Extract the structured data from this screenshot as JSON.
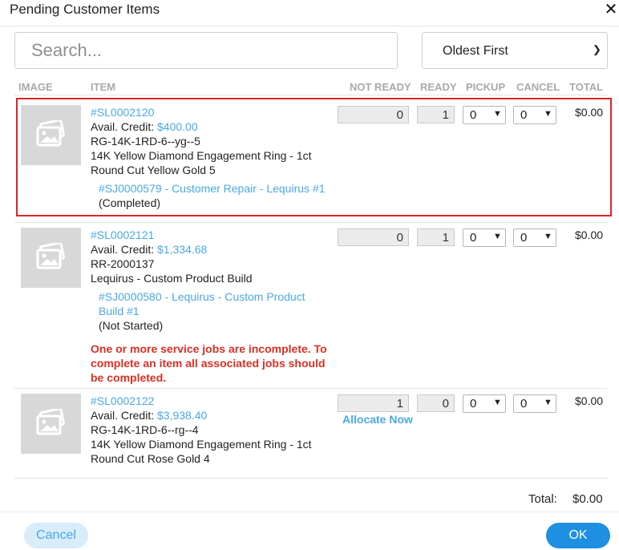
{
  "dialog": {
    "title": "Pending Customer Items",
    "close_icon": "close-icon"
  },
  "search": {
    "placeholder": "Search..."
  },
  "sort": {
    "selected": "Oldest First"
  },
  "columns": {
    "image": "IMAGE",
    "item": "ITEM",
    "not_ready": "NOT READY",
    "ready": "READY",
    "pickup": "PICKUP",
    "cancel": "CANCEL",
    "total": "TOTAL"
  },
  "rows": [
    {
      "sl": "#SL0002120",
      "credit_label": "Avail. Credit:",
      "credit": "$400.00",
      "sku": "RG-14K-1RD-6--yg--5",
      "desc1": "14K Yellow Diamond Engagement Ring - 1ct",
      "desc2": "Round Cut Yellow Gold 5",
      "job": "#SJ0000579 - Customer Repair - Lequirus #1",
      "job_status": "(Completed)",
      "not_ready": "0",
      "ready": "1",
      "pickup": "0",
      "cancel": "0",
      "total": "$0.00"
    },
    {
      "sl": "#SL0002121",
      "credit_label": "Avail. Credit:",
      "credit": "$1,334.68",
      "sku": "RR-2000137",
      "desc1": "Lequirus - Custom Product Build",
      "job_line1": "#SJ0000580 - Lequirus - Custom Product",
      "job_line2": "Build #1",
      "job_status": "(Not Started)",
      "warning": "One or more service jobs are incomplete. To complete an item all associated jobs should be completed.",
      "not_ready": "0",
      "ready": "1",
      "pickup": "0",
      "cancel": "0",
      "total": "$0.00"
    },
    {
      "sl": "#SL0002122",
      "credit_label": "Avail. Credit:",
      "credit": "$3,938.40",
      "sku": "RG-14K-1RD-6--rg--4",
      "desc1": "14K Yellow Diamond Engagement Ring - 1ct",
      "desc2": "Round Cut Rose Gold 4",
      "allocate": "Allocate Now",
      "not_ready": "1",
      "ready": "0",
      "pickup": "0",
      "cancel": "0",
      "total": "$0.00"
    }
  ],
  "footer": {
    "total_label": "Total:",
    "total_value": "$0.00",
    "cancel_label": "Cancel",
    "ok_label": "OK"
  },
  "colors": {
    "link": "#4aa8e6",
    "warning": "#d93025",
    "highlight": "#e02424",
    "primary": "#1e8fe1"
  }
}
